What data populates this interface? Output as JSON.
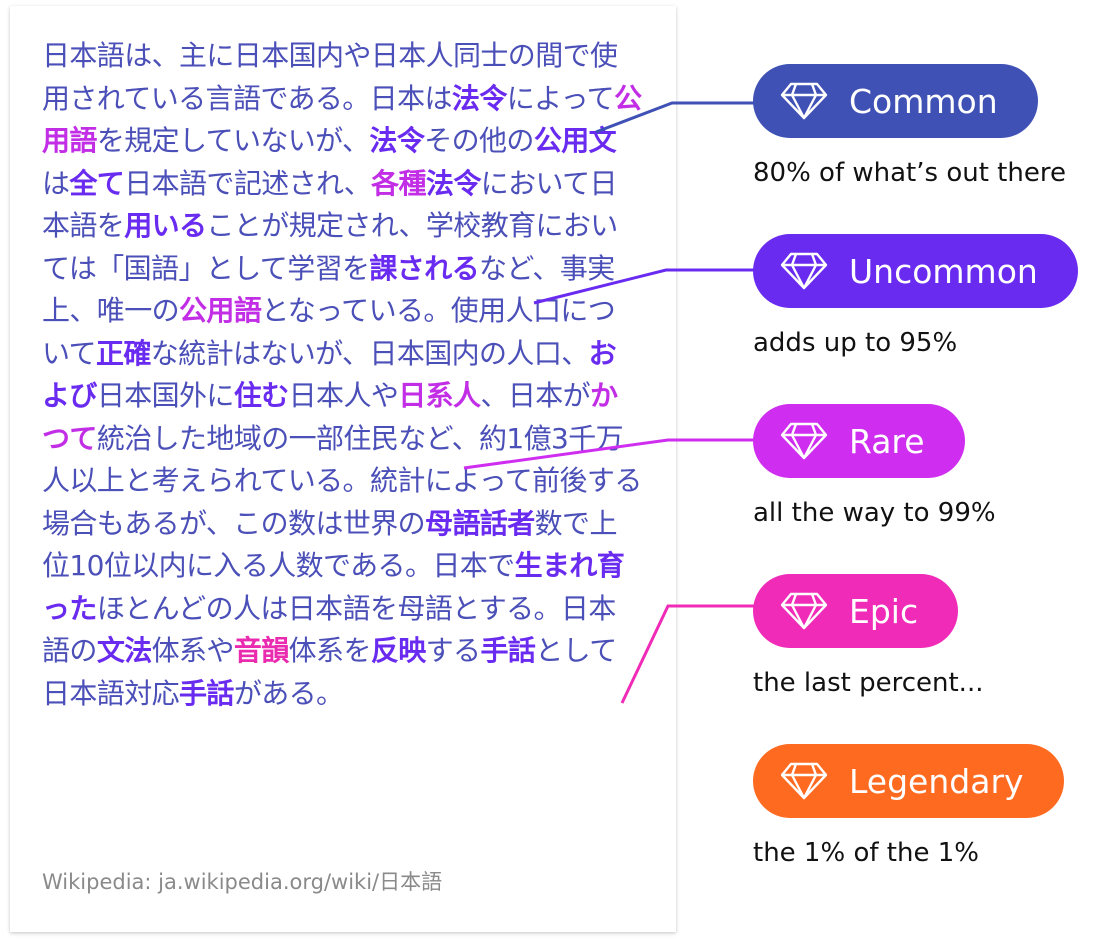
{
  "passage": [
    {
      "t": "日本語は、主に日本国内や日本人同士の間で使用されている言語である。日本は",
      "c": ""
    },
    {
      "t": "法令",
      "c": "uncommon"
    },
    {
      "t": "によって",
      "c": ""
    },
    {
      "t": "公用語",
      "c": "rare"
    },
    {
      "t": "を規定していないが、",
      "c": ""
    },
    {
      "t": "法令",
      "c": "uncommon"
    },
    {
      "t": "その他の",
      "c": ""
    },
    {
      "t": "公用文",
      "c": "uncommon"
    },
    {
      "t": "は",
      "c": ""
    },
    {
      "t": "全て",
      "c": "uncommon"
    },
    {
      "t": "日本語で記述され、",
      "c": ""
    },
    {
      "t": "各種",
      "c": "rare"
    },
    {
      "t": "法令",
      "c": "uncommon"
    },
    {
      "t": "において日本語を",
      "c": ""
    },
    {
      "t": "用いる",
      "c": "uncommon"
    },
    {
      "t": "ことが規定され、学校教育においては「国語」として学習を",
      "c": ""
    },
    {
      "t": "課される",
      "c": "uncommon"
    },
    {
      "t": "など、事実上、唯一の",
      "c": ""
    },
    {
      "t": "公用語",
      "c": "rare"
    },
    {
      "t": "となっている。使用人口について",
      "c": ""
    },
    {
      "t": "正確",
      "c": "uncommon"
    },
    {
      "t": "な統計はないが、日本国内の人口、",
      "c": ""
    },
    {
      "t": "および",
      "c": "uncommon"
    },
    {
      "t": "日本国外に",
      "c": ""
    },
    {
      "t": "住む",
      "c": "uncommon"
    },
    {
      "t": "日本人や",
      "c": ""
    },
    {
      "t": "日系人",
      "c": "rare"
    },
    {
      "t": "、日本が",
      "c": ""
    },
    {
      "t": "かつて",
      "c": "rare"
    },
    {
      "t": "統治した地域の一部住民など、約1億3千万人以上と考えられている。統計によって前後する場合もあるが、この数は世界の",
      "c": ""
    },
    {
      "t": "母語話者",
      "c": "uncommon"
    },
    {
      "t": "数で上位10位以内に入る人数である。日本で",
      "c": ""
    },
    {
      "t": "生まれ育った",
      "c": "uncommon"
    },
    {
      "t": "ほとんどの人は日本語を母語とする。日本語の",
      "c": ""
    },
    {
      "t": "文法",
      "c": "uncommon"
    },
    {
      "t": "体系や",
      "c": ""
    },
    {
      "t": "音韻",
      "c": "epic"
    },
    {
      "t": "体系を",
      "c": ""
    },
    {
      "t": "反映",
      "c": "uncommon"
    },
    {
      "t": "する",
      "c": ""
    },
    {
      "t": "手話",
      "c": "uncommon"
    },
    {
      "t": "として日本語対応",
      "c": ""
    },
    {
      "t": "手話",
      "c": "uncommon"
    },
    {
      "t": "がある。",
      "c": ""
    }
  ],
  "source": "Wikipedia: ja.wikipedia.org/wiki/日本語",
  "tiers": [
    {
      "label": "Common",
      "desc": "80% of what’s out there",
      "color": "#3f51b5",
      "icon": "diamond-icon"
    },
    {
      "label": "Uncommon",
      "desc": "adds up to 95%",
      "color": "#6a2bf0",
      "icon": "diamond-icon"
    },
    {
      "label": "Rare",
      "desc": "all the way to 99%",
      "color": "#cf2ef0",
      "icon": "diamond-icon"
    },
    {
      "label": "Epic",
      "desc": "the last percent...",
      "color": "#f02bb8",
      "icon": "diamond-icon"
    },
    {
      "label": "Legendary",
      "desc": "the 1% of the 1%",
      "color": "#ff6a21",
      "icon": "diamond-icon"
    }
  ]
}
